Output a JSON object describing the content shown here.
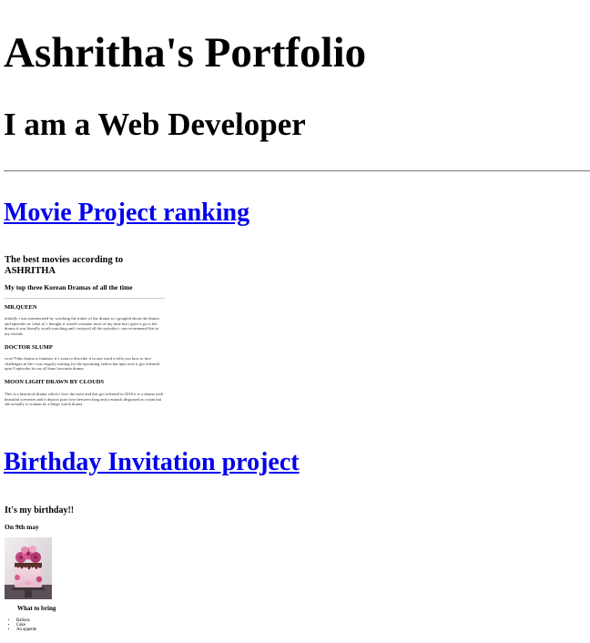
{
  "header": {
    "title": "Ashritha's Portfolio",
    "subtitle": "I am a Web Developer"
  },
  "projects": {
    "movie": {
      "link_label": "Movie Project ranking",
      "preview": {
        "title": "The best movies according to ASHRITHA",
        "subtitle": "My top three Korean Dramas of all the time",
        "items": [
          {
            "name": "MR.QUEEN",
            "text": "initially i was mesmerized by watching the trailer of the drama so i googled about the drama and episodes as 'what to' i thought it would consume most of my time but i gave a go to the drama it was literally worth watching and i enjoyed all the episodes i can recommend this to my friends"
          },
          {
            "name": "DOCTOR SLUMP",
            "text": "wow!!!this drama is fantastic if i want to describe it in one word it tells you how to face challenges in life i was eagerly waiting for the upcoming videos but upto now it got released upto 8 episodes its my all time favourite drama"
          },
          {
            "name": "MOON LIGHT DRAWN BY CLOUDS",
            "text": "This is a historical drama which i love the most and this got released in 2016 it is a drama with beautiful sceneries and it depicts pure love between king and a eunuch disguised as a man but she actually is woman its a binge watch drama"
          }
        ]
      }
    },
    "birthday": {
      "link_label": "Birthday Invitation project",
      "preview": {
        "title": "It's my birthday!!",
        "date": "On 9th may",
        "image_icon": "cake-photo",
        "bring_heading": "What to bring",
        "bring_items": [
          "Ballons",
          "Cake",
          "An appetite"
        ]
      }
    }
  },
  "colors": {
    "link": "#0000ee",
    "rule": "#888888"
  }
}
